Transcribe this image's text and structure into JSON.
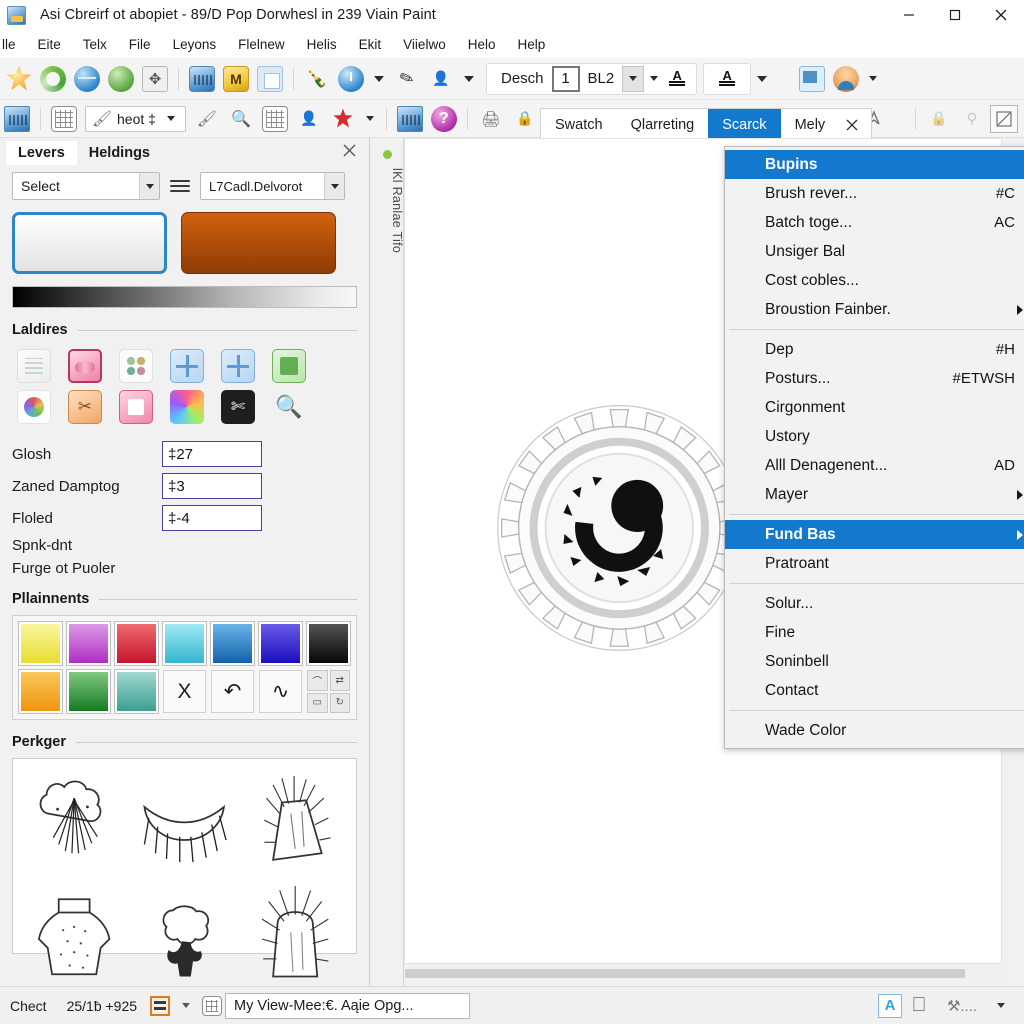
{
  "window": {
    "title": "Asi Cbreirf ot abopiet - 89/D Pop Dorwhesl in 239 Viain Paint",
    "app_icon": "app-icon",
    "controls": {
      "minimize": "minimize",
      "maximize": "maximize",
      "close": "close"
    }
  },
  "menubar": {
    "items": [
      {
        "label": "lle"
      },
      {
        "label": "Eite"
      },
      {
        "label": "Telx"
      },
      {
        "label": "File"
      },
      {
        "label": "Leyons"
      },
      {
        "label": "Flelnew"
      },
      {
        "label": "Helis"
      },
      {
        "label": "Ekit"
      },
      {
        "label": "Viielwo"
      },
      {
        "label": "Helo"
      },
      {
        "label": "Help"
      }
    ]
  },
  "toolbar_primary": {
    "icons": [
      "star-icon",
      "ring-refresh-icon",
      "globe-icon",
      "globe-green-icon",
      "move-frame-icon",
      "blue-image-icon",
      "yellow-chart-icon",
      "duplicate-icon",
      "bottle-icon",
      "clock-icon",
      "pen-icon",
      "people-icon",
      "monitor-icon",
      "avatar-icon"
    ],
    "format_group": {
      "label": "Desch",
      "number_value": "1",
      "style_label": "BL2",
      "dropdown": "chevron-down-icon",
      "align_icon": "underline-a-icon",
      "align_icon_2": "underline-a-icon"
    }
  },
  "toolbar_secondary": {
    "icons": [
      "card-icon",
      "table-icon",
      "brush-icon",
      "grid-icon",
      "stamp-icon",
      "red-star-icon",
      "table-green-icon",
      "help-icon",
      "scan-icon",
      "lock-icon"
    ],
    "combo": {
      "label": "heot ‡",
      "dropdown": "chevron-down-icon"
    },
    "right_icons": [
      "pointer-up-icon",
      "lock-group-icon",
      "edit-image-icon"
    ]
  },
  "tabbar": {
    "tabs": [
      {
        "label": "Swatch",
        "active": false
      },
      {
        "label": "Qlarreting",
        "active": false
      },
      {
        "label": "Scarck",
        "active": true
      },
      {
        "label": "Mely",
        "active": false
      }
    ],
    "close_icon": "close-icon"
  },
  "left_panel": {
    "tabs": [
      {
        "label": "Levers",
        "active": true
      },
      {
        "label": "Heldings",
        "active": false
      }
    ],
    "close_icon": "close-icon",
    "select": {
      "value": "Select",
      "dropdown": "chevron-down-icon"
    },
    "menu_icon": "hamburger-icon",
    "preset_combo": {
      "value": "L7Cadl.Delvorot",
      "dropdown": "chevron-down-icon"
    },
    "foreground_swatch": "#e8e8e8",
    "background_swatch": "#b24d09",
    "gradient_bar": "black-to-white-ramp",
    "sections": {
      "tools": {
        "title": "Laldires",
        "items": [
          "chart-thumb-icon",
          "pink-wave-icon",
          "four-dots-icon",
          "crosshair-icon",
          "crosshair-alt-icon",
          "green-document-icon",
          "color-burst-icon",
          "scissors-icon",
          "pink-film-icon",
          "rainbow-fan-icon",
          "black-cut-icon",
          "magnifier-icon"
        ]
      },
      "fields": [
        {
          "label": "Glosh",
          "value": "‡27"
        },
        {
          "label": "Zaned Damptog",
          "value": "‡3"
        },
        {
          "label": "Floled",
          "value": "‡-4"
        }
      ],
      "plain_rows": [
        "Spnk-dnt",
        "Furge ot Puoler"
      ],
      "palette": {
        "title": "Pllainnents",
        "colors_row1": [
          "#f2e85a",
          "#c34fd0",
          "#d6283c",
          "#5fd8e8",
          "#2f7fd0",
          "#2b22cf",
          "#2b2b2b"
        ],
        "colors_row2": [
          "#f0a32a",
          "#3b9640",
          "#62bfb0"
        ],
        "buttons": [
          "X",
          "↶",
          "∿"
        ],
        "quad_icons": [
          "arc-icon",
          "flip-icon",
          "pill-icon",
          "rotate-icon"
        ]
      },
      "preview": {
        "title": "Perkger",
        "thumbnails": [
          "cloud-burst-sketch",
          "fringe-arc-sketch",
          "spiky-cone-sketch",
          "collar-sketch",
          "tree-sketch",
          "spiky-dome-sketch"
        ]
      }
    }
  },
  "canvas": {
    "vertical_label": "lKl Ranlae Tifo",
    "status_dot_color": "#8dc63f",
    "object": "gear-wheel-graphic",
    "leader_lines": 2
  },
  "context_menu": {
    "items": [
      {
        "label": "Bupins",
        "shortcut": "",
        "selected": true,
        "submenu": false
      },
      {
        "label": "Brush rever...",
        "shortcut": "#C",
        "selected": false,
        "submenu": false
      },
      {
        "label": "Batch toge...",
        "shortcut": "AC",
        "selected": false,
        "submenu": false
      },
      {
        "label": "Unsiger Bal",
        "shortcut": "",
        "selected": false,
        "submenu": false
      },
      {
        "label": "Cost cobles...",
        "shortcut": "",
        "selected": false,
        "submenu": false
      },
      {
        "label": "Broustion Fainber.",
        "shortcut": "",
        "selected": false,
        "submenu": true
      },
      {
        "separator": true
      },
      {
        "label": "Dep",
        "shortcut": "#H",
        "selected": false,
        "submenu": false
      },
      {
        "label": "Posturs...",
        "shortcut": "#ETWSH",
        "selected": false,
        "submenu": false
      },
      {
        "label": "Cirgonment",
        "shortcut": "",
        "selected": false,
        "submenu": false
      },
      {
        "label": "Ustory",
        "shortcut": "",
        "selected": false,
        "submenu": false
      },
      {
        "label": "Alll Denagenent...",
        "shortcut": "AD",
        "selected": false,
        "submenu": false
      },
      {
        "label": "Mayer",
        "shortcut": "",
        "selected": false,
        "submenu": true
      },
      {
        "separator": true
      },
      {
        "label": "Fund Bas",
        "shortcut": "",
        "selected": true,
        "submenu": true
      },
      {
        "label": "Pratroant",
        "shortcut": "",
        "selected": false,
        "submenu": false
      },
      {
        "separator": true
      },
      {
        "label": "Solur...",
        "shortcut": "",
        "selected": false,
        "submenu": false
      },
      {
        "label": "Fine",
        "shortcut": "",
        "selected": false,
        "submenu": false
      },
      {
        "label": "Soninbell",
        "shortcut": "",
        "selected": false,
        "submenu": false
      },
      {
        "label": "Contact",
        "shortcut": "",
        "selected": false,
        "submenu": false
      },
      {
        "separator": true
      },
      {
        "label": "Wade Color",
        "shortcut": "",
        "selected": false,
        "submenu": false
      }
    ]
  },
  "statusbar": {
    "left_text": "Chect",
    "coords": "25/1ƀ +925",
    "icons": [
      "orange-book-icon",
      "chevron-down-icon",
      "grid-icon"
    ],
    "document_box": "My View-Mee:€. Aąie Opg...",
    "right_icons": [
      "blue-a-icon",
      "apple-icon",
      "tool-icon"
    ],
    "right_caret": "chevron-down-icon"
  },
  "colors": {
    "accent_blue": "#1279cf",
    "panel_bg": "#f1f1f1",
    "toolbar_bg": "#f4f4f4",
    "orange": "#b24d09"
  }
}
